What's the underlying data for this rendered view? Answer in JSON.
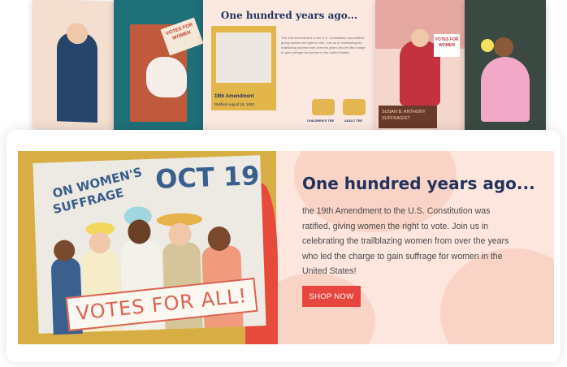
{
  "top_strip": {
    "center_card": {
      "title": "One hundred years ago...",
      "paragraph": "The 19th Amendment to the U.S. Constitution was ratified, giving women the right to vote. Join us in celebrating the trailblazing women from over the years who led the charge to gain suffrage for women in the United States!",
      "poster_caption": "19th Amendment",
      "poster_date": "Ratified August 18, 1920",
      "tees": [
        {
          "label": "CHILDREN'S TEE"
        },
        {
          "label": "ADULT TEE"
        }
      ]
    },
    "card2_caption": "VOTES FOR WOMEN",
    "card4_sign": "VOTES FOR WOMEN",
    "card4_caption": "SUSAN B. ANTHONY SUFFRAGIST"
  },
  "banner": {
    "poster_line1": "ON WOMEN'S",
    "poster_line2": "SUFFRAGE",
    "poster_date": "OCT 19",
    "sign_text": "VOTES FOR ALL!",
    "heading": "One hundred years ago...",
    "paragraph": "the 19th Amendment to the U.S. Constitution was ratified, giving women the right to vote. Join us in celebrating the trailblazing women from over the years who led the charge to gain suffrage for women in the United States!",
    "button_label": "SHOP NOW"
  },
  "colors": {
    "accent": "#e7463f",
    "heading": "#22335d",
    "banner_bg": "#fde6de",
    "poster_gold": "#d7ae43"
  }
}
